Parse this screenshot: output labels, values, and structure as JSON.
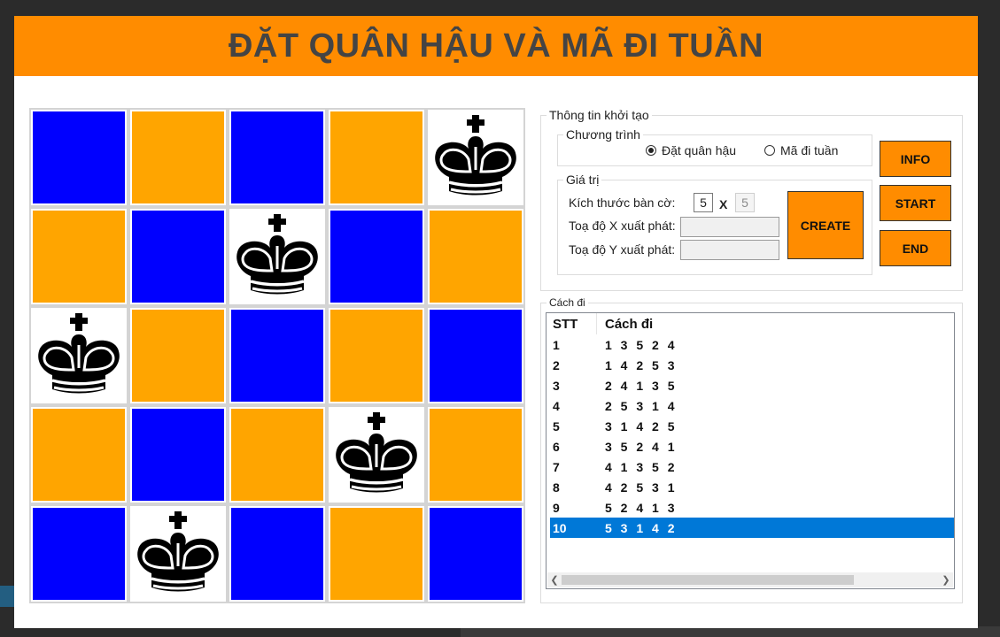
{
  "title": "ĐẶT QUÂN HẬU VÀ MÃ ĐI TUẦN",
  "board": {
    "size": 5,
    "colors": {
      "blue": "#0000ff",
      "orange": "#ffa500",
      "queen_bg": "#ffffff"
    },
    "queen_icon": "black-king-piece-icon",
    "rows": [
      [
        "blue",
        "orange",
        "blue",
        "orange",
        "queen"
      ],
      [
        "orange",
        "blue",
        "queen",
        "blue",
        "orange"
      ],
      [
        "queen",
        "orange",
        "blue",
        "orange",
        "blue"
      ],
      [
        "orange",
        "blue",
        "orange",
        "queen",
        "orange"
      ],
      [
        "blue",
        "queen",
        "blue",
        "orange",
        "blue"
      ]
    ]
  },
  "init_group": {
    "legend": "Thông tin khởi tạo",
    "program": {
      "legend": "Chương trình",
      "options": [
        {
          "label": "Đặt quân hậu",
          "checked": true
        },
        {
          "label": "Mã đi tuần",
          "checked": false
        }
      ]
    },
    "values": {
      "legend": "Giá trị",
      "board_size_label": "Kích thước bàn cờ:",
      "size_x": "5",
      "size_sep": "X",
      "size_y": "5",
      "start_x_label": "Toạ độ X xuất phát:",
      "start_x_value": "",
      "start_y_label": "Toạ độ Y xuất phát:",
      "start_y_value": "",
      "create_label": "CREATE"
    }
  },
  "buttons": {
    "info": "INFO",
    "start": "START",
    "end": "END"
  },
  "accent_color": "#ff8c00",
  "moves_group": {
    "legend": "Cách đi",
    "columns": [
      "STT",
      "Cách đi"
    ],
    "rows": [
      {
        "stt": "1",
        "moves": "1 3 5 2 4"
      },
      {
        "stt": "2",
        "moves": "1 4 2 5 3"
      },
      {
        "stt": "3",
        "moves": "2 4 1 3 5"
      },
      {
        "stt": "4",
        "moves": "2 5 3 1 4"
      },
      {
        "stt": "5",
        "moves": "3 1 4 2 5"
      },
      {
        "stt": "6",
        "moves": "3 5 2 4 1"
      },
      {
        "stt": "7",
        "moves": "4 1 3 5 2"
      },
      {
        "stt": "8",
        "moves": "4 2 5 3 1"
      },
      {
        "stt": "9",
        "moves": "5 2 4 1 3"
      },
      {
        "stt": "10",
        "moves": "5 3 1 4 2"
      }
    ],
    "selected_row": "10"
  }
}
